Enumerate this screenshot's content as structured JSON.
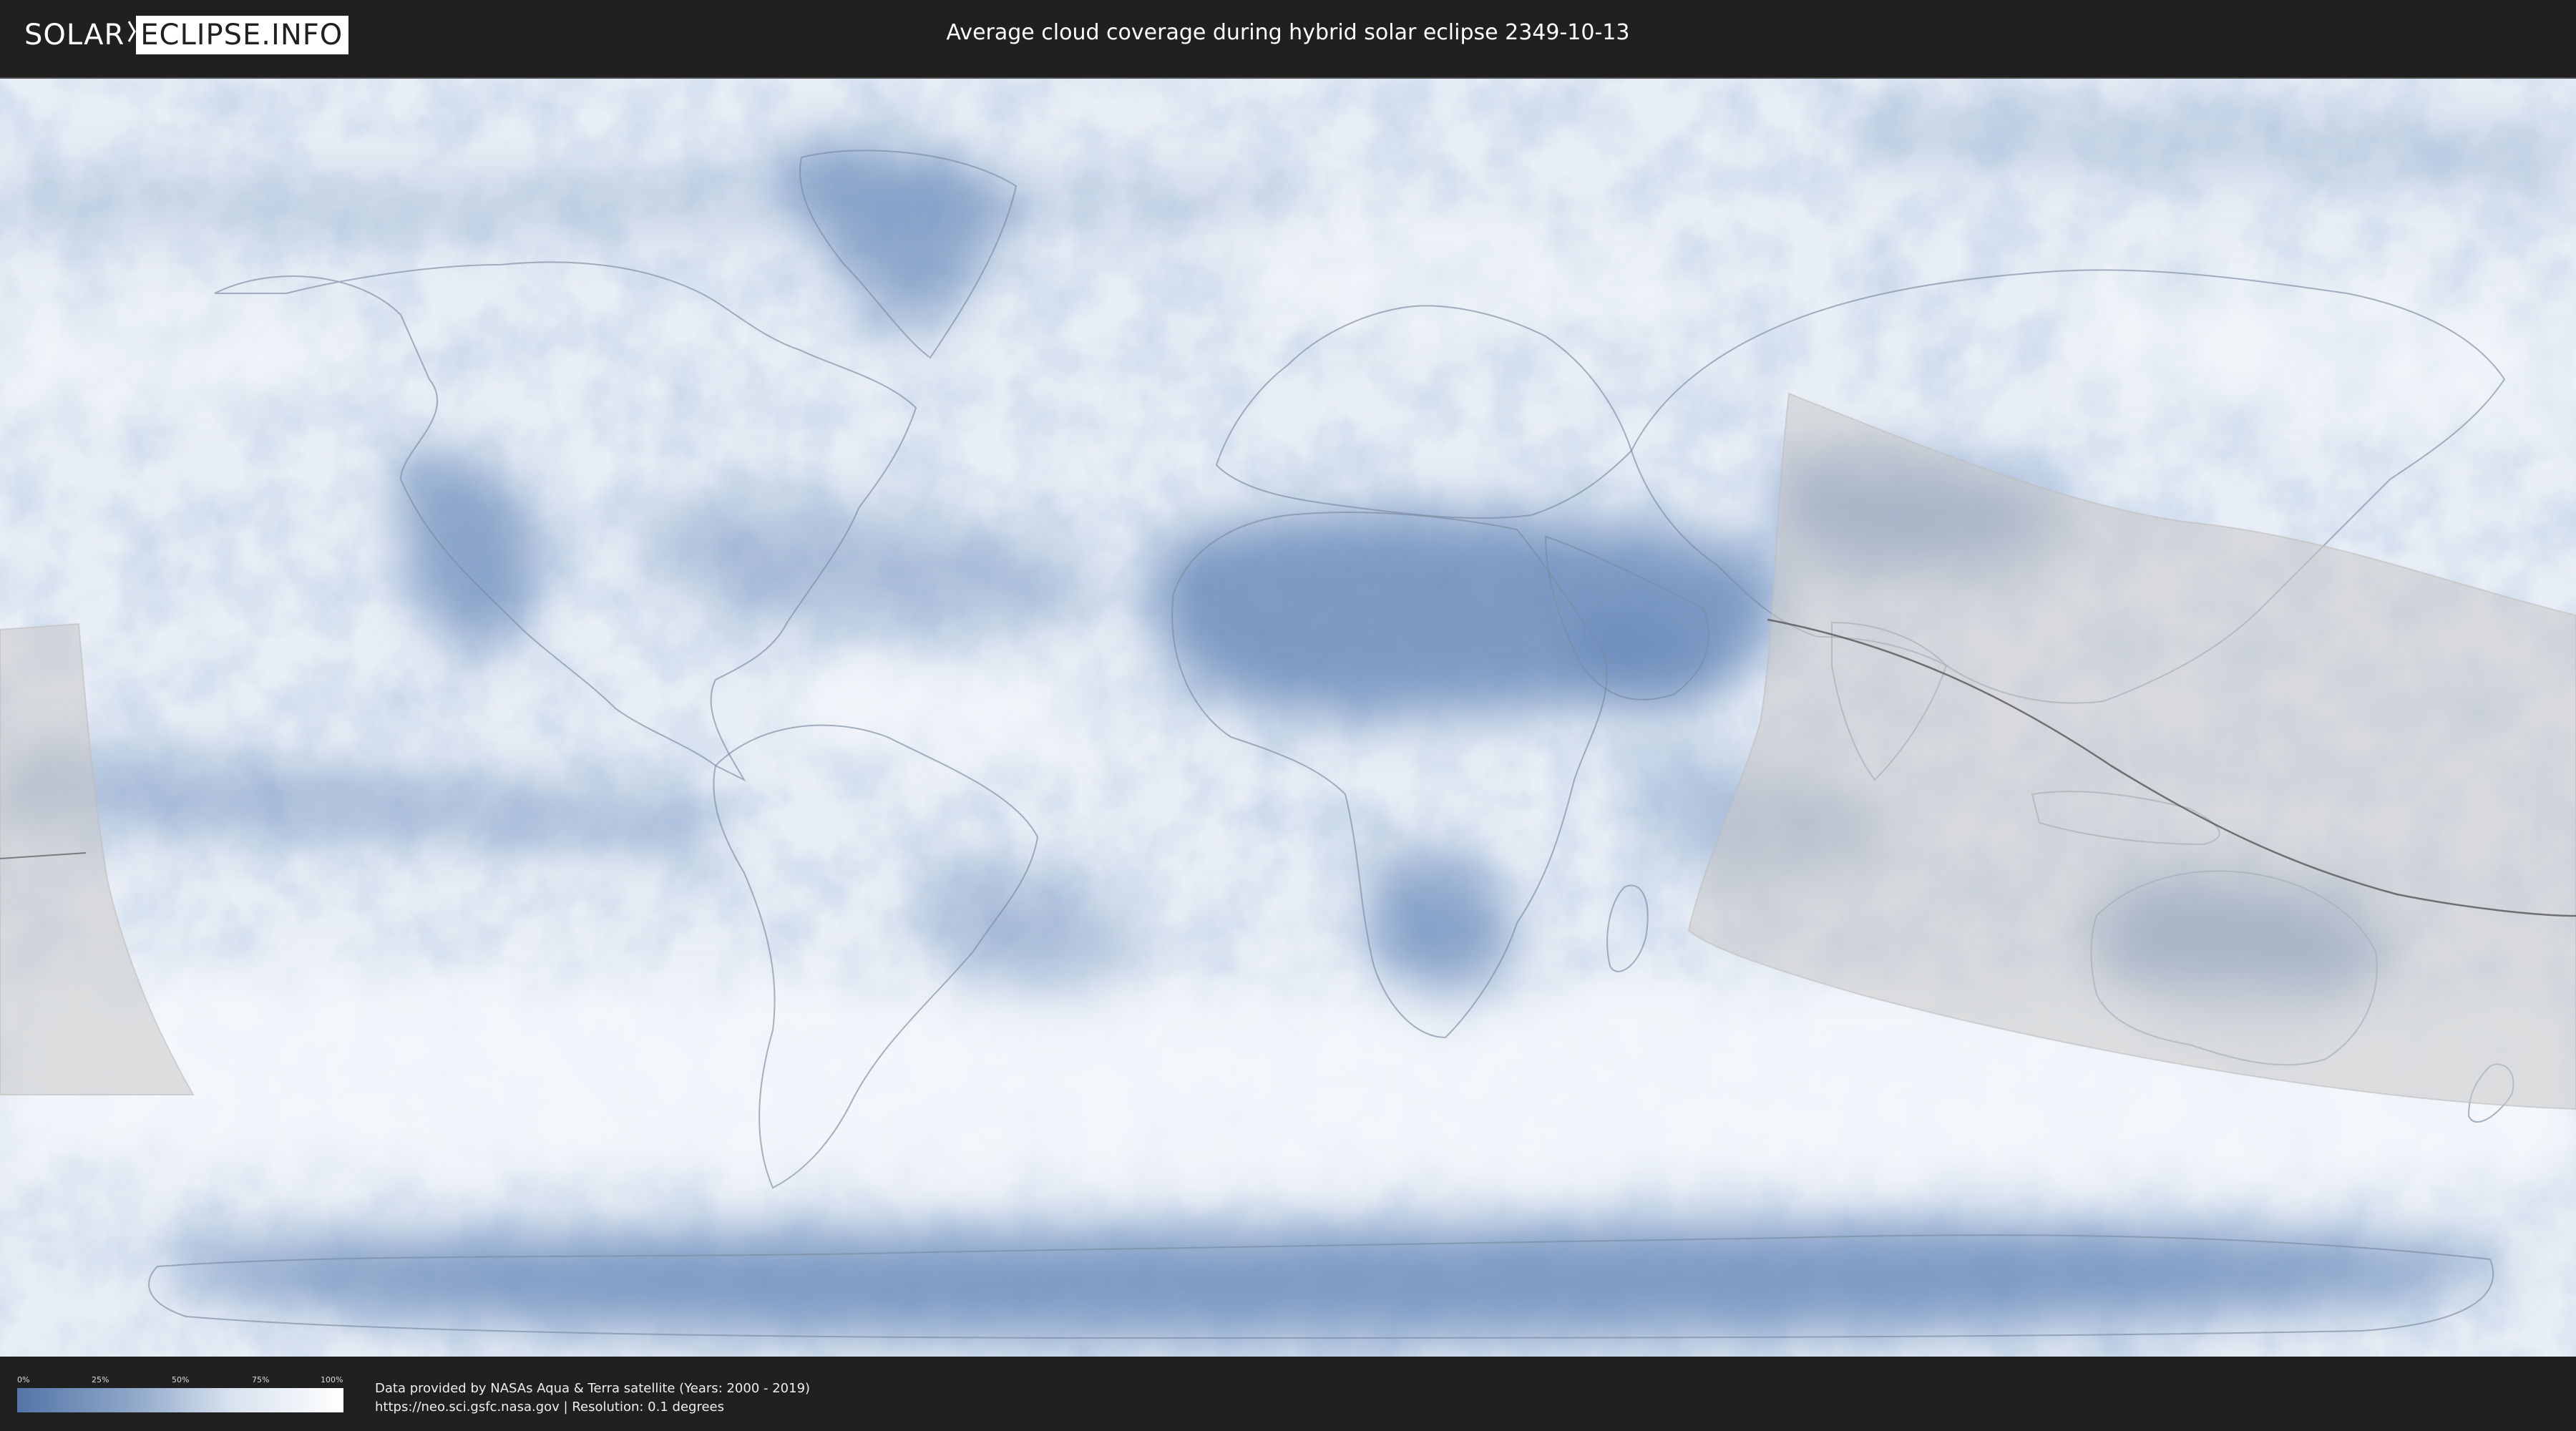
{
  "header": {
    "logo_part1": "SOLAR",
    "logo_part2": "ECLIPSE.INFO",
    "title": "Average cloud coverage during hybrid solar eclipse 2349-10-13"
  },
  "legend": {
    "ticks": [
      "0%",
      "25%",
      "50%",
      "75%",
      "100%"
    ],
    "scale_colors": [
      "#5475a7",
      "#8ea6c8",
      "#d7e1ee",
      "#ffffff"
    ]
  },
  "footer": {
    "credit_line1": "Data provided by NASAs Aqua & Terra satellite (Years: 2000 - 2019)",
    "credit_line2": "https://neo.sci.gsfc.nasa.gov | Resolution: 0.1 degrees"
  },
  "map": {
    "projection": "equirectangular",
    "layers": [
      "cloud-coverage",
      "country-borders",
      "eclipse-visibility-zone",
      "central-eclipse-path"
    ],
    "colors": {
      "clear_sky": "#6f8fbd",
      "cloudy": "#f4f7fb",
      "eclipse_zone": "#c9c9c9",
      "border_line": "#7a8aa0"
    }
  }
}
